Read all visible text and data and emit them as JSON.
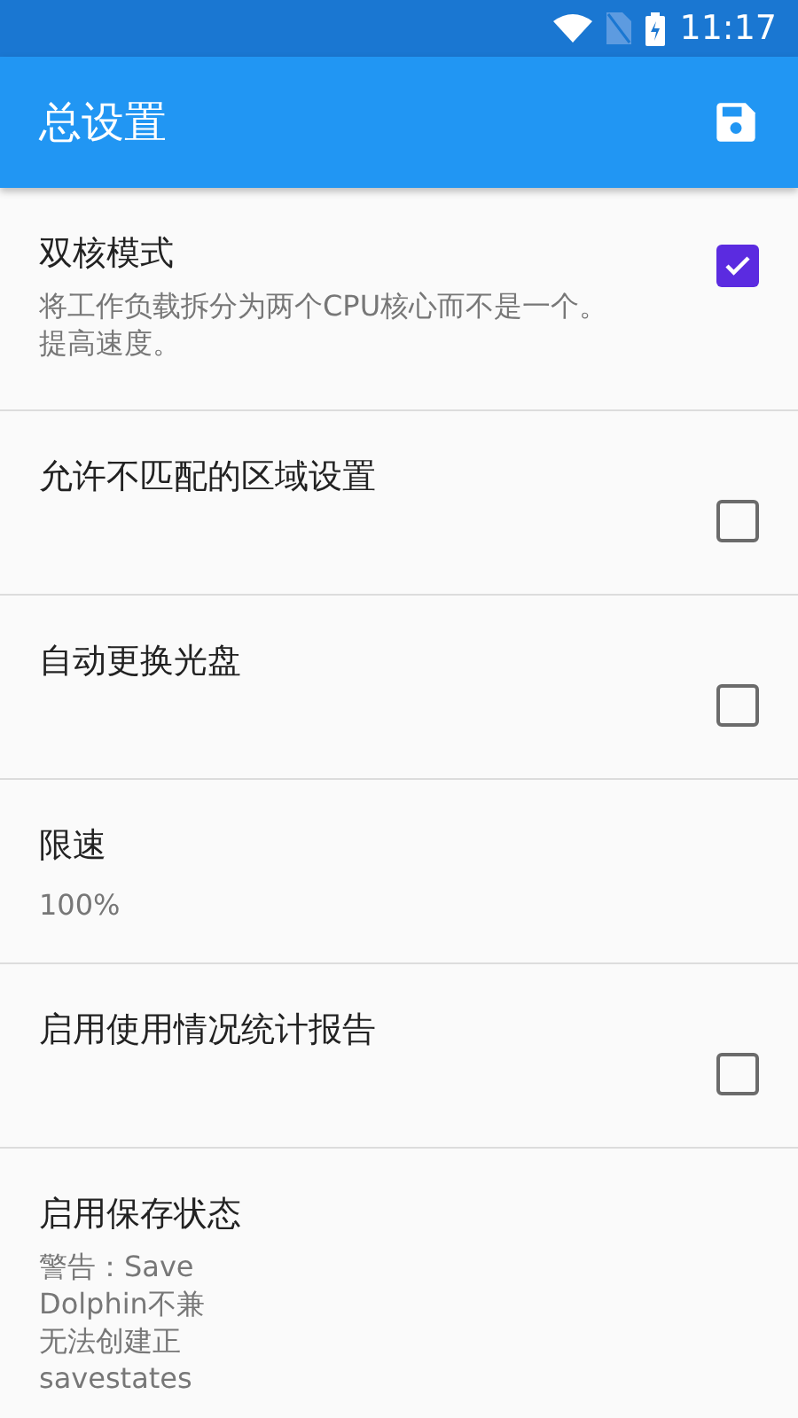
{
  "status_bar": {
    "time": "11:17"
  },
  "toolbar": {
    "title": "总设置"
  },
  "settings": [
    {
      "kind": "checkbox",
      "title": "双核模式",
      "description": [
        "将工作负载拆分为两个CPU核心而不是一个。提高速度。"
      ],
      "checked": true
    },
    {
      "kind": "checkbox",
      "title": "允许不匹配的区域设置",
      "checked": false
    },
    {
      "kind": "checkbox",
      "title": "自动更换光盘",
      "checked": false
    },
    {
      "kind": "value",
      "title": "限速",
      "value": "100%"
    },
    {
      "kind": "checkbox",
      "title": "启用使用情况统计报告",
      "checked": false
    },
    {
      "kind": "text",
      "title": "启用保存状态",
      "description": [
        "警告：Save",
        "Dolphin不兼",
        "无法创建正",
        "savestates"
      ]
    }
  ]
}
